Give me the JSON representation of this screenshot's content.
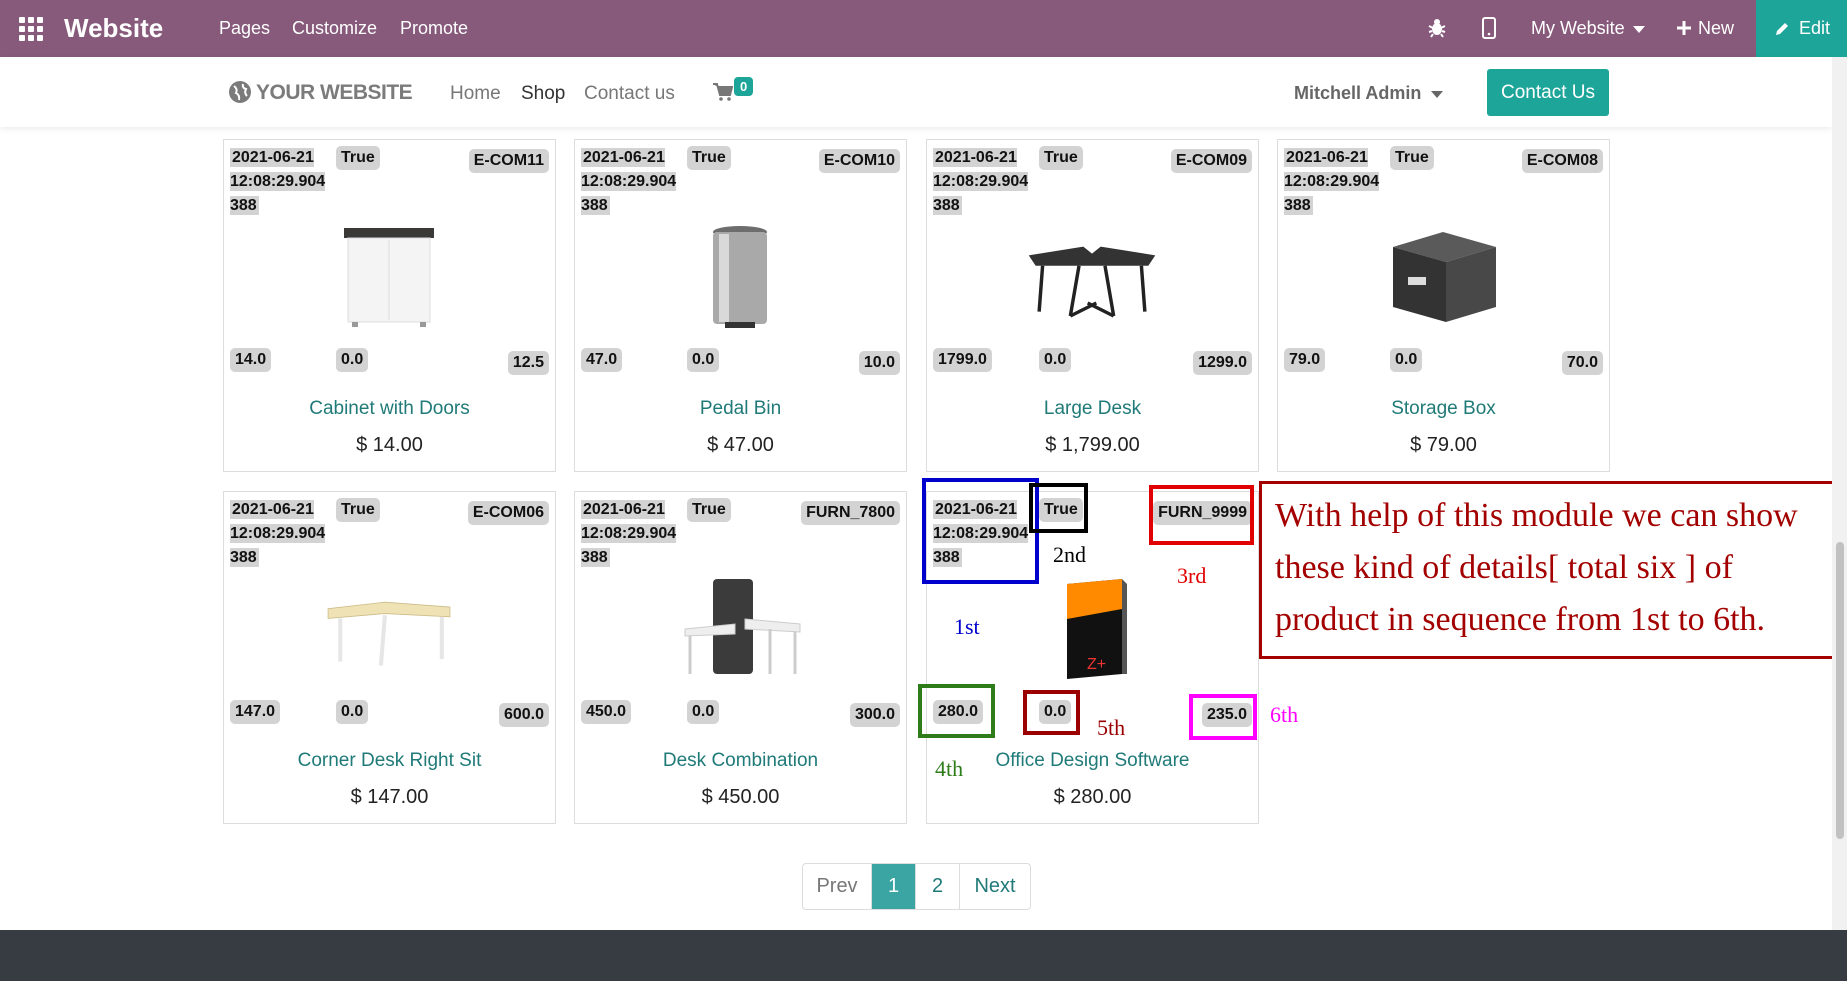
{
  "adminbar": {
    "brand": "Website",
    "menu": [
      "Pages",
      "Customize",
      "Promote"
    ],
    "website_selector": "My Website",
    "new_label": "New",
    "edit_label": "Edit",
    "icons": [
      "apps-grid-icon",
      "bug-icon",
      "mobile-icon",
      "plus-icon",
      "pencil-icon"
    ]
  },
  "header": {
    "logo": "YOUR WEBSITE",
    "nav": [
      "Home",
      "Shop",
      "Contact us"
    ],
    "cart_count": "0",
    "user": "Mitchell Admin",
    "contact_button": "Contact Us"
  },
  "products": [
    {
      "date": "2021-06-21 12:08:29.904 388",
      "flag": "True",
      "code": "E-COM11",
      "v1": "14.0",
      "v2": "0.0",
      "v3": "12.5",
      "name": "Cabinet with Doors",
      "price": "$ 14.00",
      "image": "cabinet"
    },
    {
      "date": "2021-06-21 12:08:29.904 388",
      "flag": "True",
      "code": "E-COM10",
      "v1": "47.0",
      "v2": "0.0",
      "v3": "10.0",
      "name": "Pedal Bin",
      "price": "$ 47.00",
      "image": "bin"
    },
    {
      "date": "2021-06-21 12:08:29.904 388",
      "flag": "True",
      "code": "E-COM09",
      "v1": "1799.0",
      "v2": "0.0",
      "v3": "1299.0",
      "name": "Large Desk",
      "price": "$ 1,799.00",
      "image": "desk"
    },
    {
      "date": "2021-06-21 12:08:29.904 388",
      "flag": "True",
      "code": "E-COM08",
      "v1": "79.0",
      "v2": "0.0",
      "v3": "70.0",
      "name": "Storage Box",
      "price": "$ 79.00",
      "image": "box"
    },
    {
      "date": "2021-06-21 12:08:29.904 388",
      "flag": "True",
      "code": "E-COM06",
      "v1": "147.0",
      "v2": "0.0",
      "v3": "600.0",
      "name": "Corner Desk Right Sit",
      "price": "$ 147.00",
      "image": "corner"
    },
    {
      "date": "2021-06-21 12:08:29.904 388",
      "flag": "True",
      "code": "FURN_7800",
      "v1": "450.0",
      "v2": "0.0",
      "v3": "300.0",
      "name": "Desk Combination",
      "price": "$ 450.00",
      "image": "combo"
    },
    {
      "date": "2021-06-21 12:08:29.904 388",
      "flag": "True",
      "code": "FURN_9999",
      "v1": "280.0",
      "v2": "0.0",
      "v3": "235.0",
      "name": "Office Design Software",
      "price": "$ 280.00",
      "image": "software"
    }
  ],
  "annotations": {
    "first": "1st",
    "second": "2nd",
    "third": "3rd",
    "fourth": "4th",
    "fifth": "5th",
    "sixth": "6th",
    "note": "With help of this module we can show these kind of details[ total six ] of product in sequence from 1st to 6th.",
    "colors": {
      "first": "#0000cc",
      "second": "#000000",
      "third": "#e00000",
      "fourth": "#2e7d1a",
      "fifth": "#9b0000",
      "sixth": "#ff00ff",
      "note": "#a30000"
    }
  },
  "pagination": {
    "prev": "Prev",
    "pages": [
      "1",
      "2"
    ],
    "next": "Next",
    "active": "1"
  }
}
